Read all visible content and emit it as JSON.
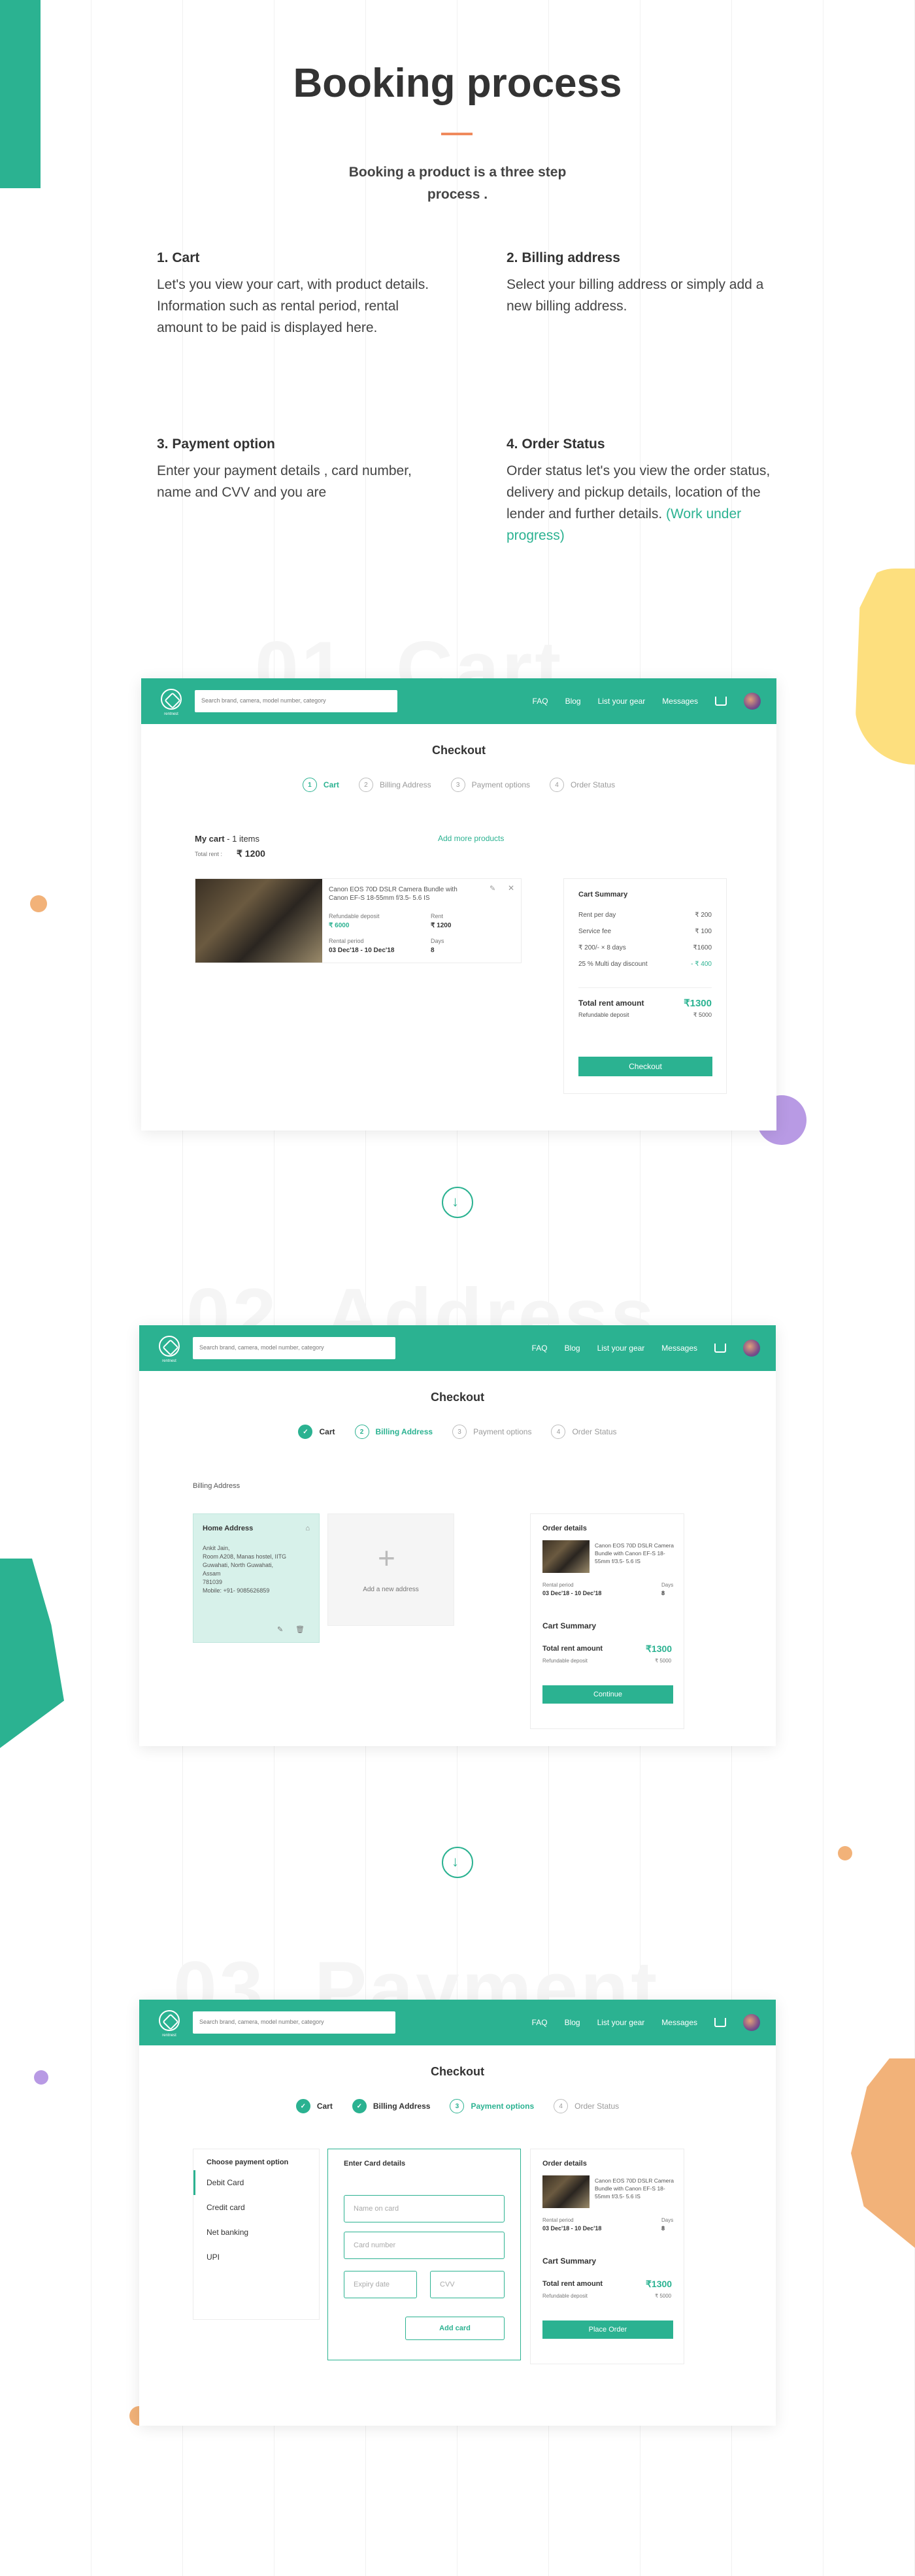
{
  "page": {
    "title": "Booking process",
    "subtitle": "Booking a product is a three step process .",
    "steps": [
      {
        "title": "1. Cart",
        "text": "Let's you view your cart, with product details. Information such as rental period, rental amount to be paid is displayed here."
      },
      {
        "title": "2. Billing address",
        "text": "Select your billing address or simply add a new billing address."
      },
      {
        "title": "3. Payment option",
        "text": "Enter your payment details , card number, name and CVV and you are"
      },
      {
        "title": "4. Order Status",
        "text": "Order status let's you view the order status, delivery and pickup details, location of the lender and further details.",
        "link": "(Work under progress)"
      }
    ],
    "watermarks": [
      "01. Cart",
      "02. Address",
      "03. Payment"
    ]
  },
  "nav": {
    "logo_text": "rentnest",
    "search_placeholder": "Search brand, camera, model number, category",
    "links": [
      "FAQ",
      "Blog",
      "List your gear",
      "Messages"
    ]
  },
  "checkout": {
    "title": "Checkout",
    "steps": [
      {
        "num": "1",
        "label": "Cart"
      },
      {
        "num": "2",
        "label": "Billing Address"
      },
      {
        "num": "3",
        "label": "Payment options"
      },
      {
        "num": "4",
        "label": "Order Status"
      }
    ]
  },
  "cart": {
    "heading": "My cart",
    "items_count": "- 1 items",
    "add_more": "Add more products",
    "total_label": "Total rent :",
    "total_value": "₹ 1200",
    "product_name": "Canon EOS 70D DSLR Camera Bundle with Canon EF-S 18-55mm f/3.5- 5.6 IS",
    "deposit_label": "Refundable deposit",
    "deposit_value": "₹ 6000",
    "rent_label": "Rent",
    "rent_value": "₹ 1200",
    "period_label": "Rental period",
    "period_value": "03 Dec'18 - 10 Dec'18",
    "days_label": "Days",
    "days_value": "8"
  },
  "summary": {
    "title": "Cart Summary",
    "rows": [
      {
        "label": "Rent per day",
        "value": "₹ 200"
      },
      {
        "label": "Service fee",
        "value": "₹ 100"
      },
      {
        "label": "₹ 200/- × 8 days",
        "value": "₹1600"
      },
      {
        "label": "25 % Multi day discount",
        "value": "- ₹ 400"
      }
    ],
    "total_label": "Total rent amount",
    "total_value": "₹1300",
    "deposit_label": "Refundable deposit",
    "deposit_value": "₹ 5000",
    "checkout_btn": "Checkout"
  },
  "address": {
    "section_label": "Billing Address",
    "home_title": "Home Address",
    "home_lines": [
      "Ankit Jain,",
      "Room A208, Manas hostel, IITG",
      "Guwahati, North Guwahati,",
      "Assam",
      "781039",
      "Mobile: +91- 9085626859"
    ],
    "add_new": "Add a new address",
    "order_title": "Order details",
    "product_name": "Canon EOS 70D DSLR Camera Bundle with Canon EF-S 18-55mm f/3.5- 5.6 IS",
    "period_label": "Rental period",
    "period_value": "03 Dec'18 - 10 Dec'18",
    "days_label": "Days",
    "days_value": "8",
    "summary_title": "Cart Summary",
    "total_label": "Total rent amount",
    "total_value": "₹1300",
    "deposit_label": "Refundable deposit",
    "deposit_value": "₹ 5000",
    "continue_btn": "Continue"
  },
  "payment": {
    "options_title": "Choose payment option",
    "options": [
      "Debit Card",
      "Credit card",
      "Net banking",
      "UPI"
    ],
    "card_title": "Enter Card details",
    "name_placeholder": "Name on card",
    "number_placeholder": "Card number",
    "expiry_placeholder": "Expiry date",
    "cvv_placeholder": "CVV",
    "add_card": "Add card",
    "place_order": "Place Order"
  },
  "colors": {
    "accent": "#2bb291",
    "orange": "#f08a5d"
  }
}
